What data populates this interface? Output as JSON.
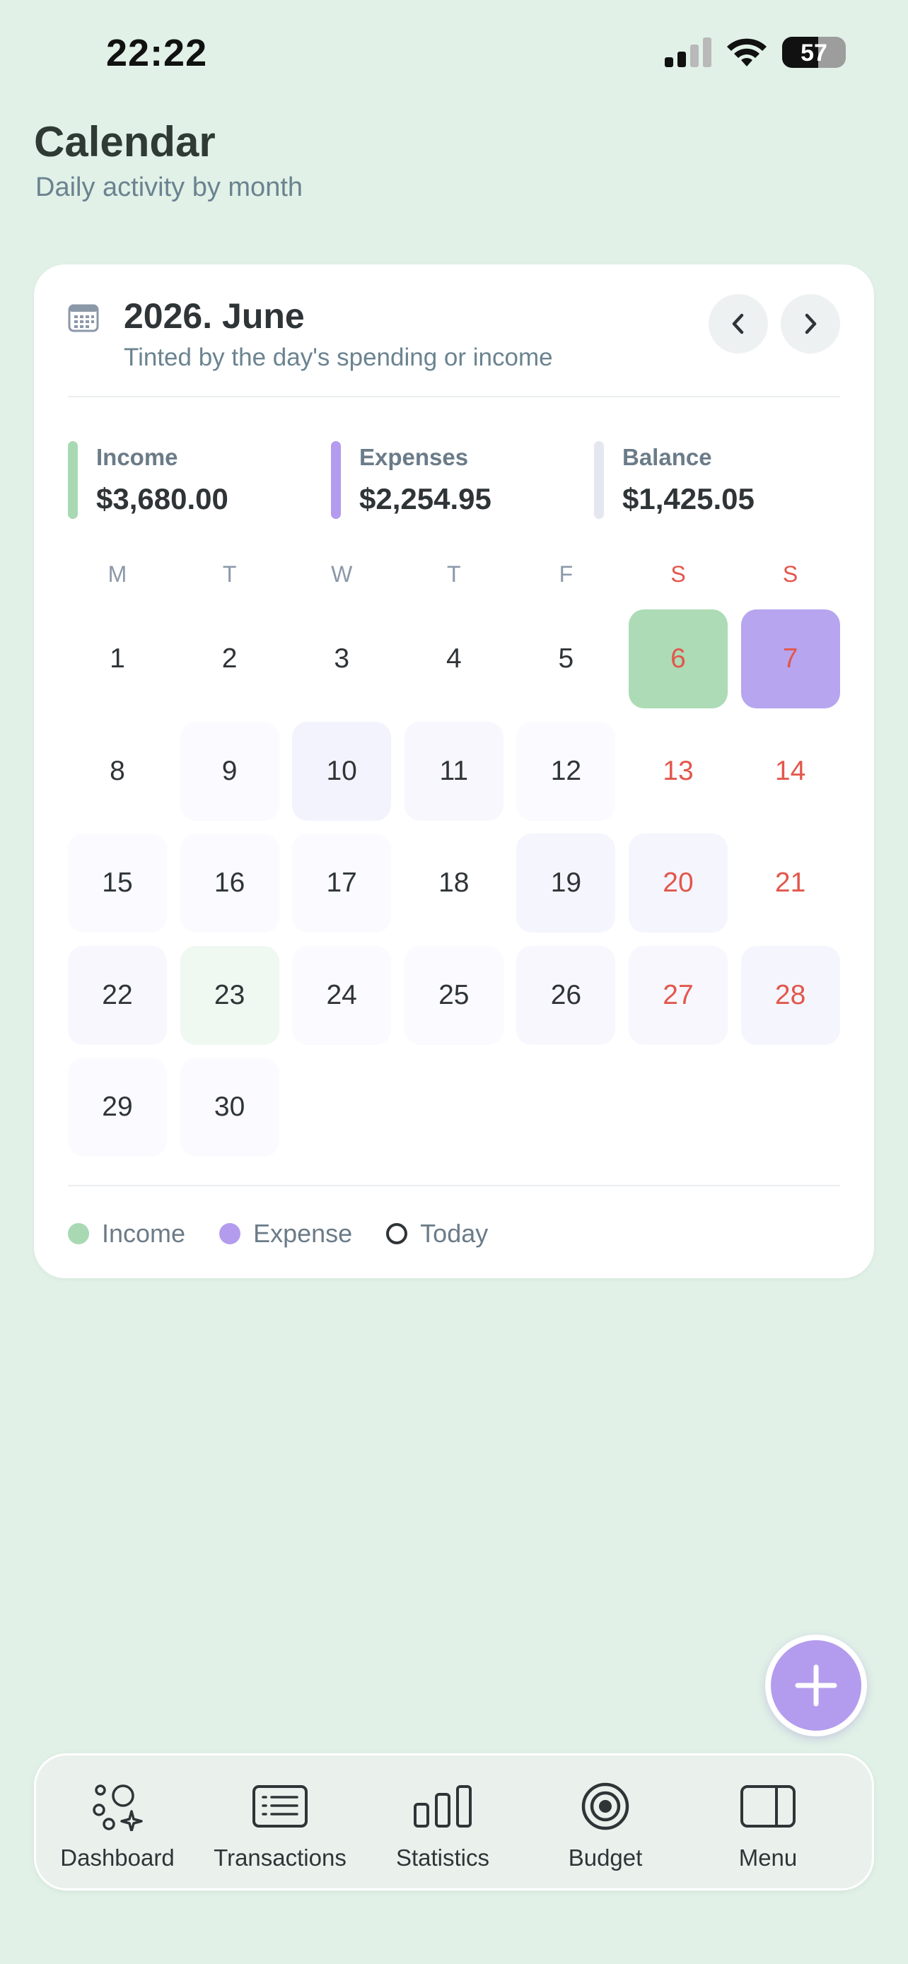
{
  "status": {
    "time": "22:22",
    "battery": "57",
    "battery_level": 0.57
  },
  "header": {
    "title": "Calendar",
    "subtitle": "Daily activity by month"
  },
  "card": {
    "title": "2026. June",
    "subtitle": "Tinted by the day's spending or income",
    "icon": "calendar-icon",
    "prev_icon": "chevron-left-icon",
    "next_icon": "chevron-right-icon"
  },
  "summary": [
    {
      "label": "Income",
      "value": "$3,680.00",
      "color": "#a8d9b3"
    },
    {
      "label": "Expenses",
      "value": "$2,254.95",
      "color": "#b39cee"
    },
    {
      "label": "Balance",
      "value": "$1,425.05",
      "color": "#e4e7ef"
    }
  ],
  "weekdays": [
    "M",
    "T",
    "W",
    "T",
    "F",
    "S",
    "S"
  ],
  "days": [
    {
      "n": "1",
      "bg": "#ffffff"
    },
    {
      "n": "2",
      "bg": "#ffffff"
    },
    {
      "n": "3",
      "bg": "#ffffff"
    },
    {
      "n": "4",
      "bg": "#ffffff"
    },
    {
      "n": "5",
      "bg": "#ffffff"
    },
    {
      "n": "6",
      "bg": "#acdbb5"
    },
    {
      "n": "7",
      "bg": "#b7a5ef"
    },
    {
      "n": "8",
      "bg": "#ffffff"
    },
    {
      "n": "9",
      "bg": "#fafaff"
    },
    {
      "n": "10",
      "bg": "#f3f3fd"
    },
    {
      "n": "11",
      "bg": "#f7f7fd"
    },
    {
      "n": "12",
      "bg": "#fafaff"
    },
    {
      "n": "13",
      "bg": "#ffffff"
    },
    {
      "n": "14",
      "bg": "#ffffff"
    },
    {
      "n": "15",
      "bg": "#fafaff"
    },
    {
      "n": "16",
      "bg": "#fafaff"
    },
    {
      "n": "17",
      "bg": "#fafaff"
    },
    {
      "n": "18",
      "bg": "#ffffff"
    },
    {
      "n": "19",
      "bg": "#f5f5fd"
    },
    {
      "n": "20",
      "bg": "#f5f5fd"
    },
    {
      "n": "21",
      "bg": "#ffffff"
    },
    {
      "n": "22",
      "bg": "#f7f7fd"
    },
    {
      "n": "23",
      "bg": "#eff8f1"
    },
    {
      "n": "24",
      "bg": "#fafaff"
    },
    {
      "n": "25",
      "bg": "#fafaff"
    },
    {
      "n": "26",
      "bg": "#f7f7fd"
    },
    {
      "n": "27",
      "bg": "#f7f7fd"
    },
    {
      "n": "28",
      "bg": "#f5f5fd"
    },
    {
      "n": "29",
      "bg": "#fbfbff"
    },
    {
      "n": "30",
      "bg": "#fbfbff"
    }
  ],
  "legend": [
    {
      "label": "Income",
      "color": "#a8d9b3",
      "style": "fill"
    },
    {
      "label": "Expense",
      "color": "#b39cee",
      "style": "fill"
    },
    {
      "label": "Today",
      "color": "#2f3437",
      "style": "ring"
    }
  ],
  "fab": {
    "icon": "plus-icon",
    "color": "#b39cee"
  },
  "tabs": [
    {
      "label": "Dashboard",
      "icon": "dashboard-icon"
    },
    {
      "label": "Transactions",
      "icon": "transactions-icon"
    },
    {
      "label": "Statistics",
      "icon": "statistics-icon"
    },
    {
      "label": "Budget",
      "icon": "budget-icon"
    },
    {
      "label": "Menu",
      "icon": "menu-icon"
    }
  ]
}
